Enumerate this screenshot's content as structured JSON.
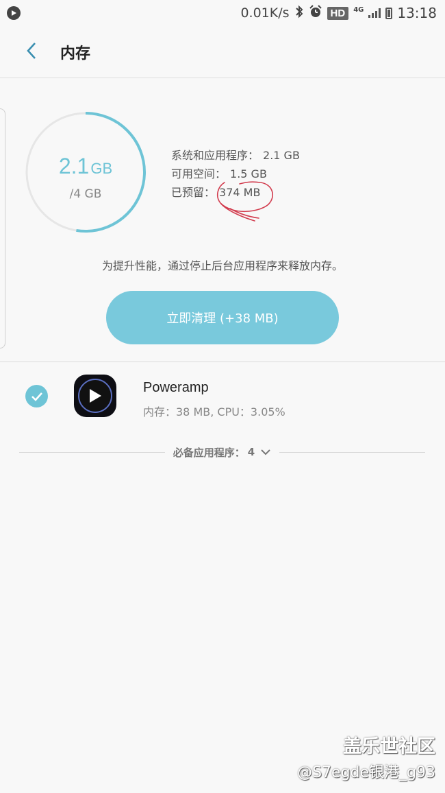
{
  "status_bar": {
    "net_speed": "0.01K/s",
    "hd_badge": "HD",
    "network_type": "4G",
    "time": "13:18",
    "icons": [
      "play-indicator-icon",
      "bluetooth-icon",
      "alarm-icon",
      "signal-icon",
      "battery-icon"
    ]
  },
  "header": {
    "title": "内存",
    "back_icon": "chevron-left-icon"
  },
  "memory": {
    "used_value": "2.1",
    "used_unit": "GB",
    "total": "/4 GB",
    "usage_fraction": 0.525,
    "ring_color": "#6ec4d6",
    "ring_track_color": "#e6e6e6",
    "rows": [
      {
        "label": "系统和应用程序：",
        "value": "2.1 GB"
      },
      {
        "label": "可用空间：",
        "value": "1.5 GB"
      },
      {
        "label": "已预留：",
        "value": "374 MB"
      }
    ],
    "annotation_color": "#d23c4e"
  },
  "hint": "为提升性能，通过停止后台应用程序来释放内存。",
  "clean_button": {
    "label": "立即清理 (+38 MB)",
    "color": "#79c9dc"
  },
  "apps": [
    {
      "name": "Poweramp",
      "detail": "内存：38 MB, CPU：3.05%",
      "checked": true,
      "icon": "poweramp-play-icon"
    }
  ],
  "essential_section": {
    "label": "必备应用程序：",
    "count": "4"
  },
  "watermark": {
    "brand": "盖乐世社区",
    "user": "@S7egde银港_g93"
  }
}
